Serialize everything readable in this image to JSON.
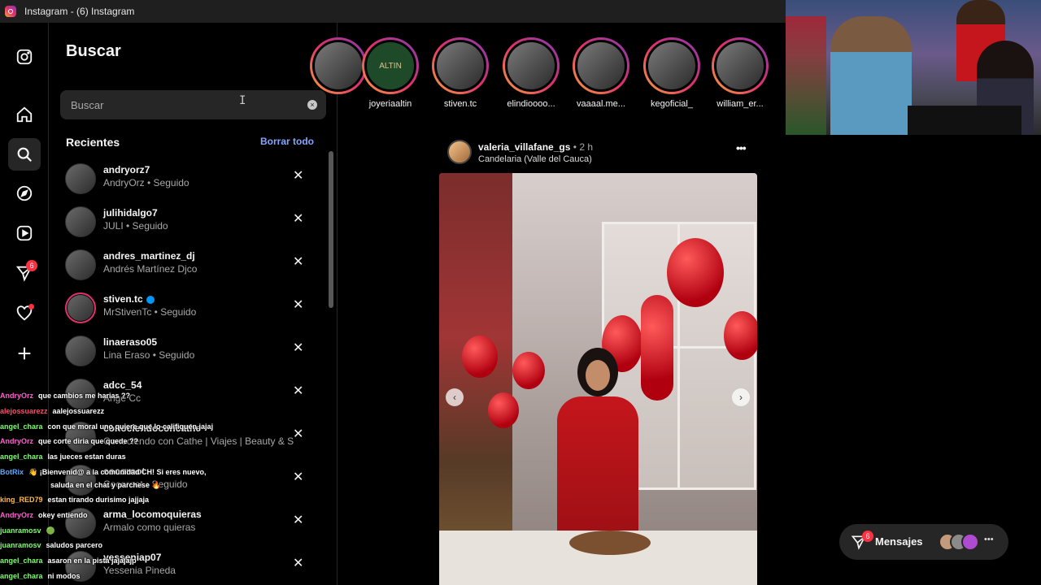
{
  "window": {
    "title": "Instagram - (6) Instagram"
  },
  "nav": {
    "items": [
      {
        "name": "instagram-logo-icon",
        "label": "Instagram"
      },
      {
        "name": "home-icon",
        "label": "Inicio"
      },
      {
        "name": "search-icon",
        "label": "Buscar"
      },
      {
        "name": "explore-icon",
        "label": "Explorar"
      },
      {
        "name": "reels-icon",
        "label": "Reels"
      },
      {
        "name": "messages-icon",
        "label": "Mensajes"
      },
      {
        "name": "notifications-icon",
        "label": "Notificaciones"
      },
      {
        "name": "create-icon",
        "label": "Crear"
      }
    ],
    "messages_badge": "6"
  },
  "search": {
    "title": "Buscar",
    "placeholder": "Buscar",
    "recent_label": "Recientes",
    "clear_all_label": "Borrar todo",
    "clear_icon": "×",
    "remove_icon": "✕",
    "recents": [
      {
        "username": "andryorz7",
        "subtitle": "AndryOrz • Seguido"
      },
      {
        "username": "julihidalgo7",
        "subtitle": "JULI • Seguido"
      },
      {
        "username": "andres_martinez_dj",
        "subtitle": "Andrés Martínez Djco"
      },
      {
        "username": "stiven.tc",
        "subtitle": "MrStivenTc • Seguido",
        "verified": true
      },
      {
        "username": "linaeraso05",
        "subtitle": "Lina Eraso • Seguido"
      },
      {
        "username": "adcc_54",
        "subtitle": "Ange Cc"
      },
      {
        "username": "conociendoconcathe",
        "subtitle": "Conociendo con Cathe | Viajes | Beauty & S"
      },
      {
        "username": "cocoroot",
        "subtitle": "Cocoroot • Seguido"
      },
      {
        "username": "arma_locomoquieras",
        "subtitle": "Armalo como quieras"
      },
      {
        "username": "yesseniap07",
        "subtitle": "Yessenia Pineda"
      }
    ]
  },
  "chat": [
    {
      "user": "AndryOrz",
      "message": "que cambios me harias ??",
      "color": "#ff5fd2"
    },
    {
      "user": "alejossuarezz",
      "message": "aalejossuarezz",
      "color": "#ff4d6d"
    },
    {
      "user": "angel_chara",
      "message": "con que moral uno quiere que lo califiquen jajaj",
      "color": "#7cff6b"
    },
    {
      "user": "AndryOrz",
      "message": "que corte diria que quede ??",
      "color": "#ff5fd2"
    },
    {
      "user": "angel_chara",
      "message": "las jueces estan duras",
      "color": "#7cff6b"
    },
    {
      "user": "BotRix",
      "message": "👋 ¡Bienvenid@ a la comunidad CH! Si eres nuevo,",
      "color": "#5fa8ff"
    },
    {
      "user": "",
      "message": "saluda en el chat y parchese 🔥",
      "color": "#5fa8ff"
    },
    {
      "user": "king_RED79",
      "message": "estan tirando durisimo jajjaja",
      "color": "#ffb84d"
    },
    {
      "user": "AndryOrz",
      "message": "okey entiendo",
      "color": "#ff5fd2"
    },
    {
      "user": "juanramosv",
      "message": "🟢",
      "color": "#7cff6b"
    },
    {
      "user": "juanramosv",
      "message": "saludos parcero",
      "color": "#7cff6b"
    },
    {
      "user": "angel_chara",
      "message": "asaron en la pista jajajajp",
      "color": "#7cff6b"
    },
    {
      "user": "angel_chara",
      "message": "ni modos",
      "color": "#7cff6b"
    }
  ],
  "stories": [
    {
      "name": ""
    },
    {
      "name": "joyeriaaltin"
    },
    {
      "name": "stiven.tc"
    },
    {
      "name": "elindioooo..."
    },
    {
      "name": "vaaaal.me..."
    },
    {
      "name": "kegoficial_"
    },
    {
      "name": "william_er..."
    }
  ],
  "story_logo_text": "ALTIN",
  "post": {
    "username": "valeria_villafane_gs",
    "separator": "•",
    "time": "2 h",
    "location": "Candelaria (Valle del Cauca)",
    "more_icon": "•••",
    "prev_icon": "‹",
    "next_icon": "›"
  },
  "messages_pill": {
    "label": "Mensajes",
    "badge": "6",
    "more": "•••"
  },
  "colors": {
    "accent_link": "#85a6ff",
    "badge": "#ff3040",
    "panel_bg": "#000000",
    "input_bg": "#262626"
  }
}
